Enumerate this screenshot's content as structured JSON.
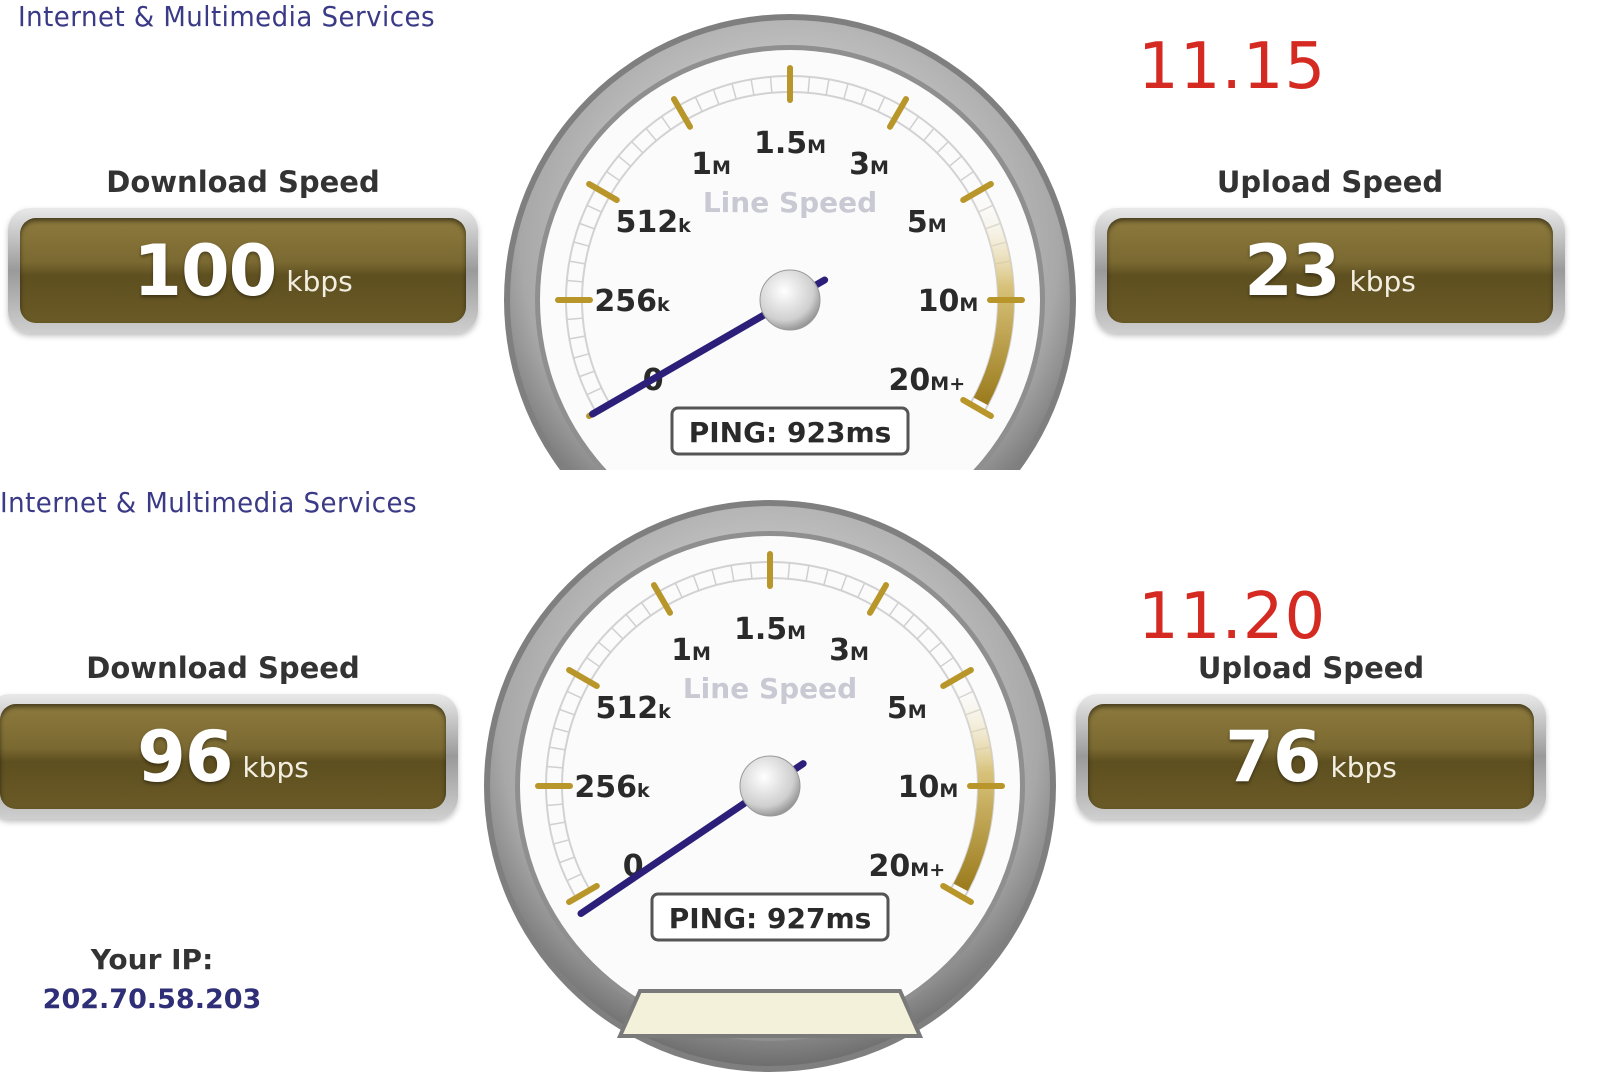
{
  "tests": [
    {
      "brand": "Internet & Multimedia Services",
      "timestamp": "11.15",
      "download": {
        "title": "Download Speed",
        "value": "100",
        "unit": "kbps"
      },
      "upload": {
        "title": "Upload Speed",
        "value": "23",
        "unit": "kbps"
      },
      "gauge_title": "Line Speed",
      "ping": "PING: 923ms"
    },
    {
      "brand": "Internet & Multimedia Services",
      "timestamp": "11.20",
      "download": {
        "title": "Download Speed",
        "value": "96",
        "unit": "kbps"
      },
      "upload": {
        "title": "Upload Speed",
        "value": "76",
        "unit": "kbps"
      },
      "gauge_title": "Line Speed",
      "ping": "PING: 927ms",
      "ip_label": "Your IP:",
      "ip_value": "202.70.58.203"
    }
  ],
  "gauge_scale": [
    {
      "num": "0",
      "unit": ""
    },
    {
      "num": "256",
      "unit": "k"
    },
    {
      "num": "512",
      "unit": "k"
    },
    {
      "num": "1",
      "unit": "M"
    },
    {
      "num": "1.5",
      "unit": "M"
    },
    {
      "num": "3",
      "unit": "M"
    },
    {
      "num": "5",
      "unit": "M"
    },
    {
      "num": "10",
      "unit": "M"
    },
    {
      "num": "20",
      "unit": "M+"
    }
  ],
  "colors": {
    "brand": "#3a3a86",
    "timestamp": "#d42a22",
    "gauge_tick": "#b8962a",
    "needle": "#2c1f7a",
    "speed_box": "#7a6931"
  }
}
